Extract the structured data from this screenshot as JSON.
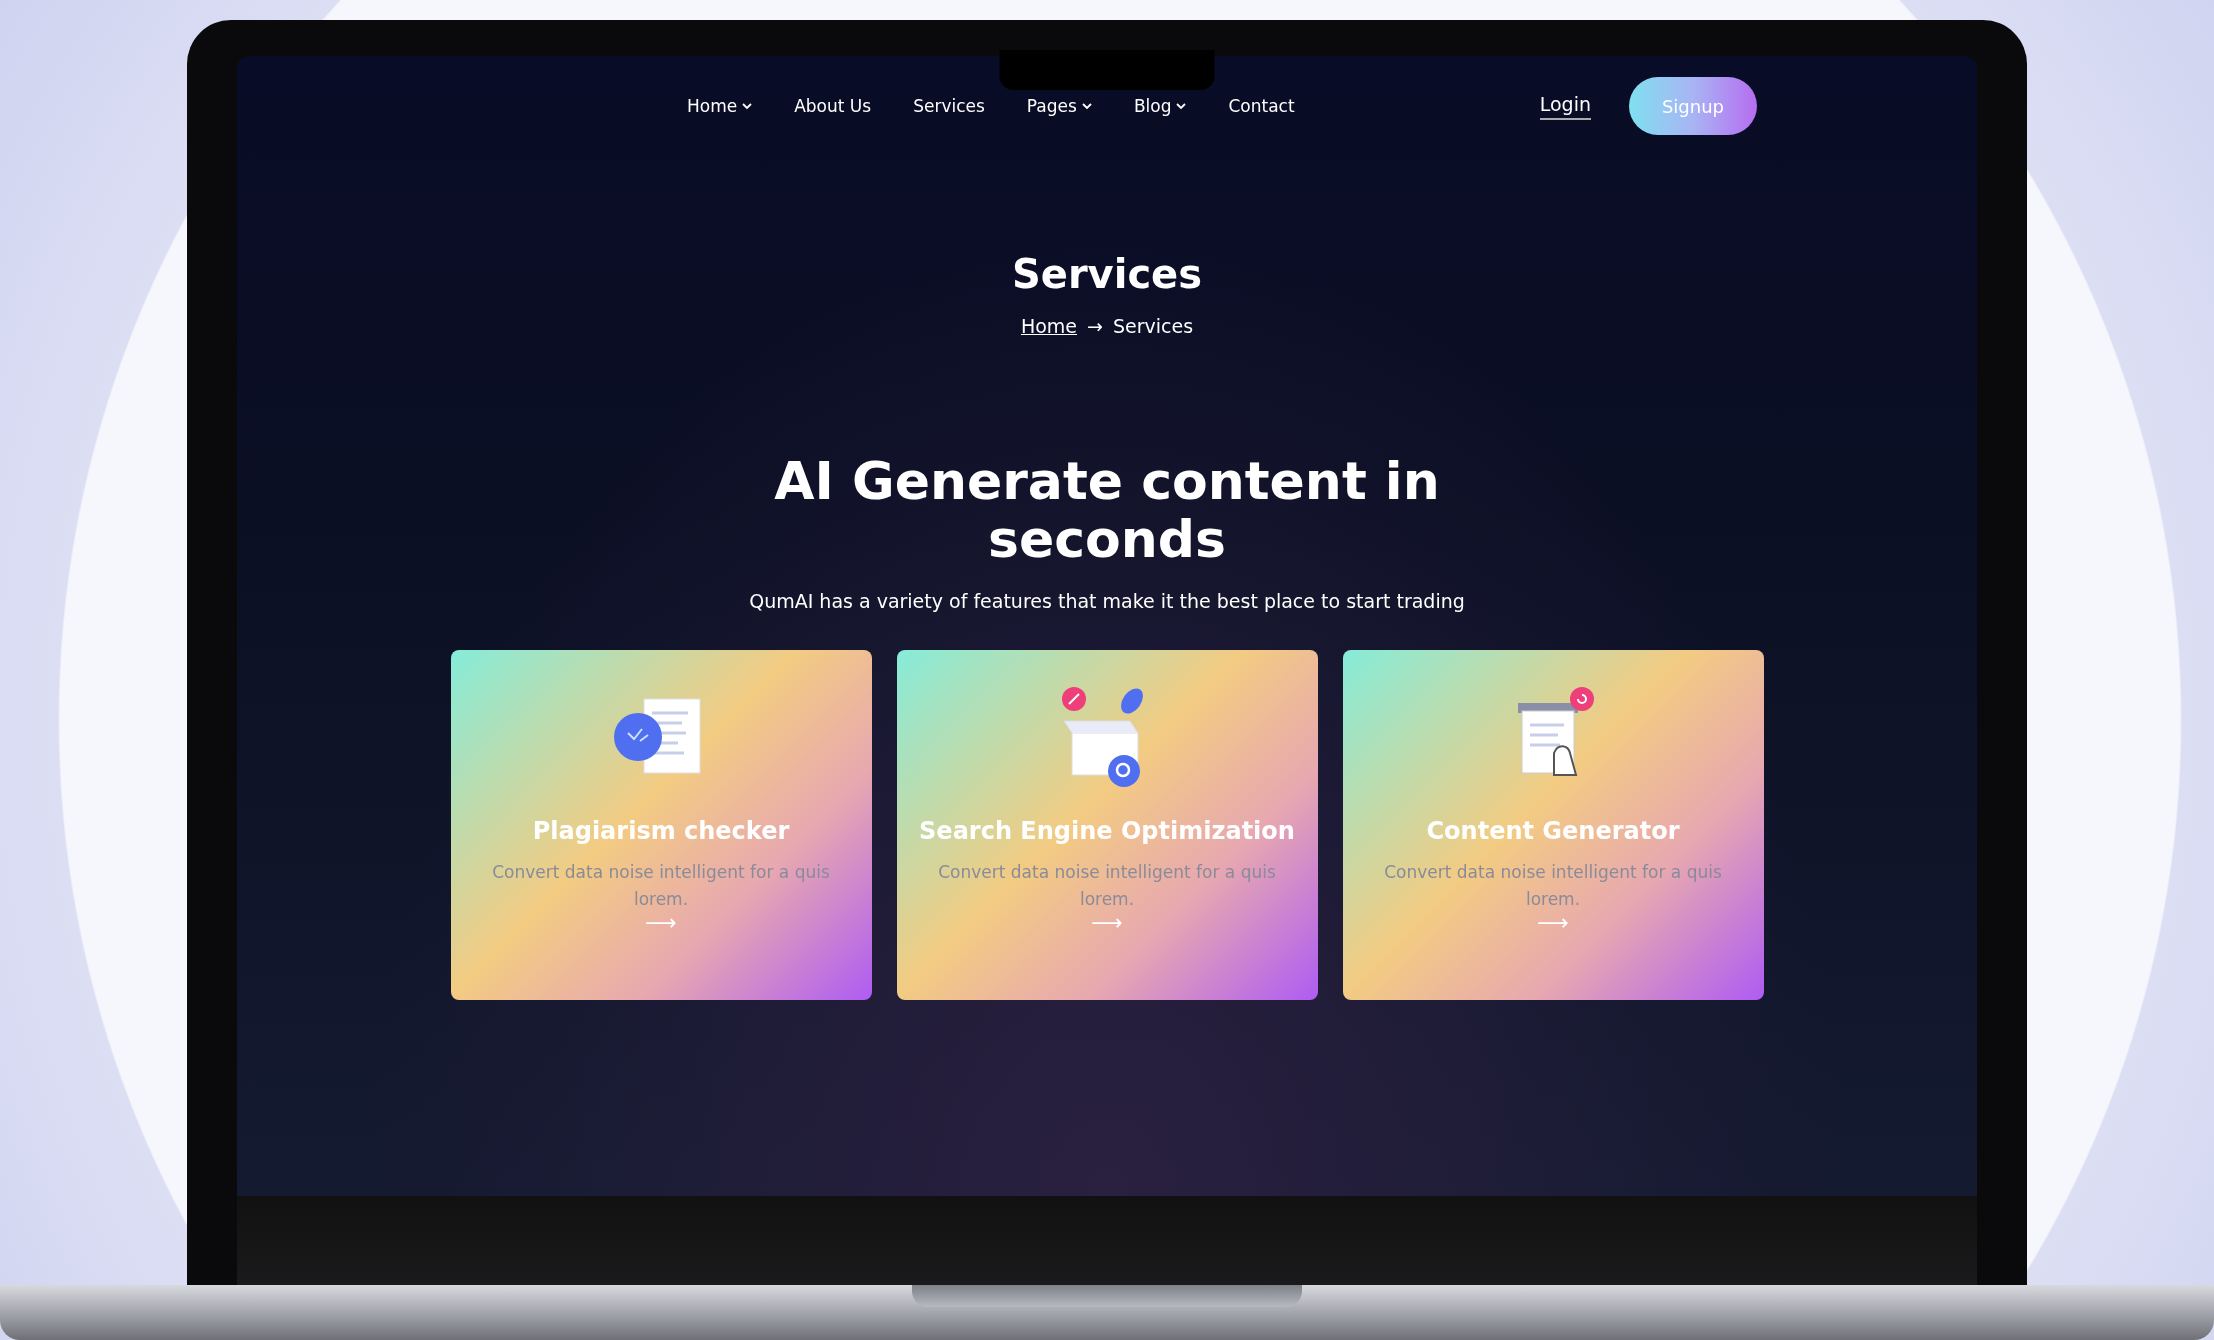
{
  "nav": {
    "items": [
      {
        "label": "Home",
        "dropdown": true
      },
      {
        "label": "About Us",
        "dropdown": false
      },
      {
        "label": "Services",
        "dropdown": false
      },
      {
        "label": "Pages",
        "dropdown": true
      },
      {
        "label": "Blog",
        "dropdown": true
      },
      {
        "label": "Contact",
        "dropdown": false
      }
    ],
    "login": "Login",
    "signup": "Signup"
  },
  "banner": {
    "title": "Services",
    "breadcrumb": {
      "home": "Home",
      "separator": "→",
      "current": "Services"
    }
  },
  "section": {
    "heading": "AI Generate content in seconds",
    "subtitle": "QumAI has a variety of features that make it the best place to start trading"
  },
  "cards": [
    {
      "kind": "plagiarism",
      "title": "Plagiarism checker",
      "text": "Convert data noise intelligent for a quis lorem.",
      "arrow": "⟶"
    },
    {
      "kind": "seo",
      "title": "Search Engine Optimization",
      "text": "Convert data noise intelligent for a quis lorem.",
      "arrow": "⟶"
    },
    {
      "kind": "content",
      "title": "Content Generator",
      "text": "Convert data noise intelligent for a quis lorem.",
      "arrow": "⟶"
    }
  ]
}
